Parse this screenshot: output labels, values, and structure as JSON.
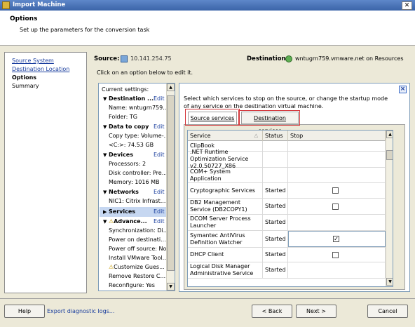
{
  "window": {
    "title": "Import Machine",
    "close": "✕"
  },
  "header": {
    "title": "Options",
    "subtitle": "Set up the parameters for the conversion task"
  },
  "nav": {
    "items": [
      "Source System",
      "Destination Location",
      "Options",
      "Summary"
    ]
  },
  "source": {
    "label": "Source:",
    "value": "10.141.254.75"
  },
  "destination": {
    "label": "Destination:",
    "value": "wntugrn759.vmware.net on Resources"
  },
  "hint": "Click on an option below to edit it.",
  "settings": {
    "title": "Current settings:",
    "edit": "Edit",
    "sections": [
      {
        "head": "Destination ...",
        "lines": [
          "Name: wntugrn759...",
          "Folder: TG"
        ]
      },
      {
        "head": "Data to copy",
        "lines": [
          "Copy type: Volume-...",
          "<C:>: 74.53 GB"
        ]
      },
      {
        "head": "Devices",
        "lines": [
          "Processors: 2",
          "Disk controller: Pre...",
          "Memory: 1016 MB"
        ]
      },
      {
        "head": "Networks",
        "lines": [
          "NIC1: Citrix Infrast..."
        ]
      },
      {
        "head": "Services",
        "lines": []
      },
      {
        "head": "Advance...",
        "lines": [
          "Synchronization: Di...",
          "Power on destinati...",
          "Power off source: No",
          "Install VMware Tool...",
          "Customize Gues...",
          "Remove Restore C...",
          "Reconfigure: Yes"
        ]
      }
    ]
  },
  "services_panel": {
    "description": "Select which services to stop on the source, or change the startup mode of any service on the destination virtual machine.",
    "tabs": [
      "Source services",
      "Destination services"
    ],
    "columns": [
      "Service",
      "Status",
      "Stop"
    ],
    "rows": [
      {
        "service": "ClipBook",
        "status": "",
        "stop": null
      },
      {
        "service": ".NET Runtime Optimization Service v2.0.50727_X86",
        "status": "",
        "stop": null
      },
      {
        "service": "COM+ System Application",
        "status": "",
        "stop": null
      },
      {
        "service": "Cryptographic Services",
        "status": "Started",
        "stop": false
      },
      {
        "service": "DB2 Management Service (DB2COPY1)",
        "status": "Started",
        "stop": false
      },
      {
        "service": "DCOM Server Process Launcher",
        "status": "Started",
        "stop": null
      },
      {
        "service": "Symantec AntiVirus Definition Watcher",
        "status": "Started",
        "stop": true
      },
      {
        "service": "DHCP Client",
        "status": "Started",
        "stop": false
      },
      {
        "service": "Logical Disk Manager Administrative Service",
        "status": "Started",
        "stop": null
      }
    ]
  },
  "buttons": {
    "help": "Help",
    "export": "Export diagnostic logs...",
    "back": "< Back",
    "next": "Next >",
    "cancel": "Cancel"
  },
  "colors": {
    "titlebar": "#3b64a8",
    "link": "#1a3e9e",
    "highlight": "#d4363a"
  }
}
